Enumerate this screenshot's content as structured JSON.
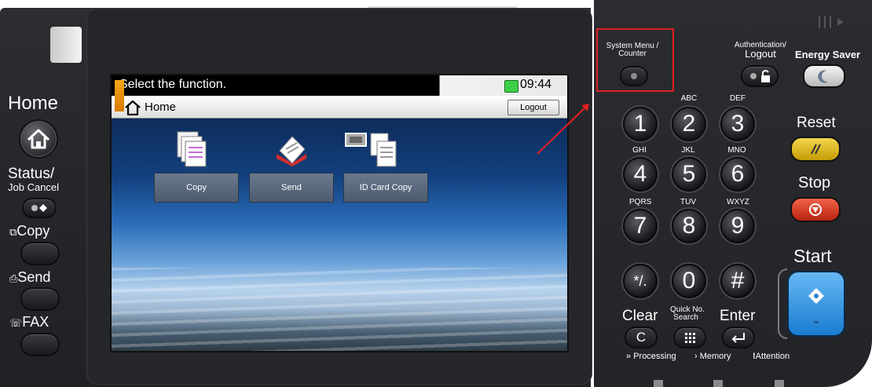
{
  "screen": {
    "message": "Select the function.",
    "time": "09:44",
    "nav_title": "Home",
    "logout_label": "Logout",
    "functions": [
      {
        "label": "Copy",
        "icon": "copy-doc-icon"
      },
      {
        "label": "Send",
        "icon": "send-icon"
      },
      {
        "label": "ID Card Copy",
        "icon": "id-card-copy-icon"
      }
    ]
  },
  "left_panel": {
    "home": "Home",
    "status_line1": "Status/",
    "status_line2": "Job Cancel",
    "copy": "Copy",
    "send": "Send",
    "fax": "FAX"
  },
  "right_panel": {
    "system_menu_line1": "System Menu /",
    "system_menu_line2": "Counter",
    "auth_line1": "Authentication/",
    "auth_line2": "Logout",
    "energy_saver": "Energy Saver",
    "reset": "Reset",
    "stop": "Stop",
    "start": "Start",
    "clear": "Clear",
    "clear_key": "C",
    "quick_no_line1": "Quick No.",
    "quick_no_line2": "Search",
    "enter": "Enter",
    "processing": "Processing",
    "memory": "Memory",
    "attention": "Attention",
    "keys": [
      {
        "digit": "1",
        "letters": ""
      },
      {
        "digit": "2",
        "letters": "ABC"
      },
      {
        "digit": "3",
        "letters": "DEF"
      },
      {
        "digit": "4",
        "letters": "GHI"
      },
      {
        "digit": "5",
        "letters": "JKL"
      },
      {
        "digit": "6",
        "letters": "MNO"
      },
      {
        "digit": "7",
        "letters": "PQRS"
      },
      {
        "digit": "8",
        "letters": "TUV"
      },
      {
        "digit": "9",
        "letters": "WXYZ"
      },
      {
        "digit": "*/.",
        "letters": ""
      },
      {
        "digit": "0",
        "letters": ""
      },
      {
        "digit": "#",
        "letters": ""
      }
    ]
  },
  "colors": {
    "highlight_box": "#e02020",
    "reset_button": "#e6c21a",
    "stop_button": "#d9361c",
    "start_button": "#1f8fe0",
    "status_led": "#3ecf4a"
  }
}
